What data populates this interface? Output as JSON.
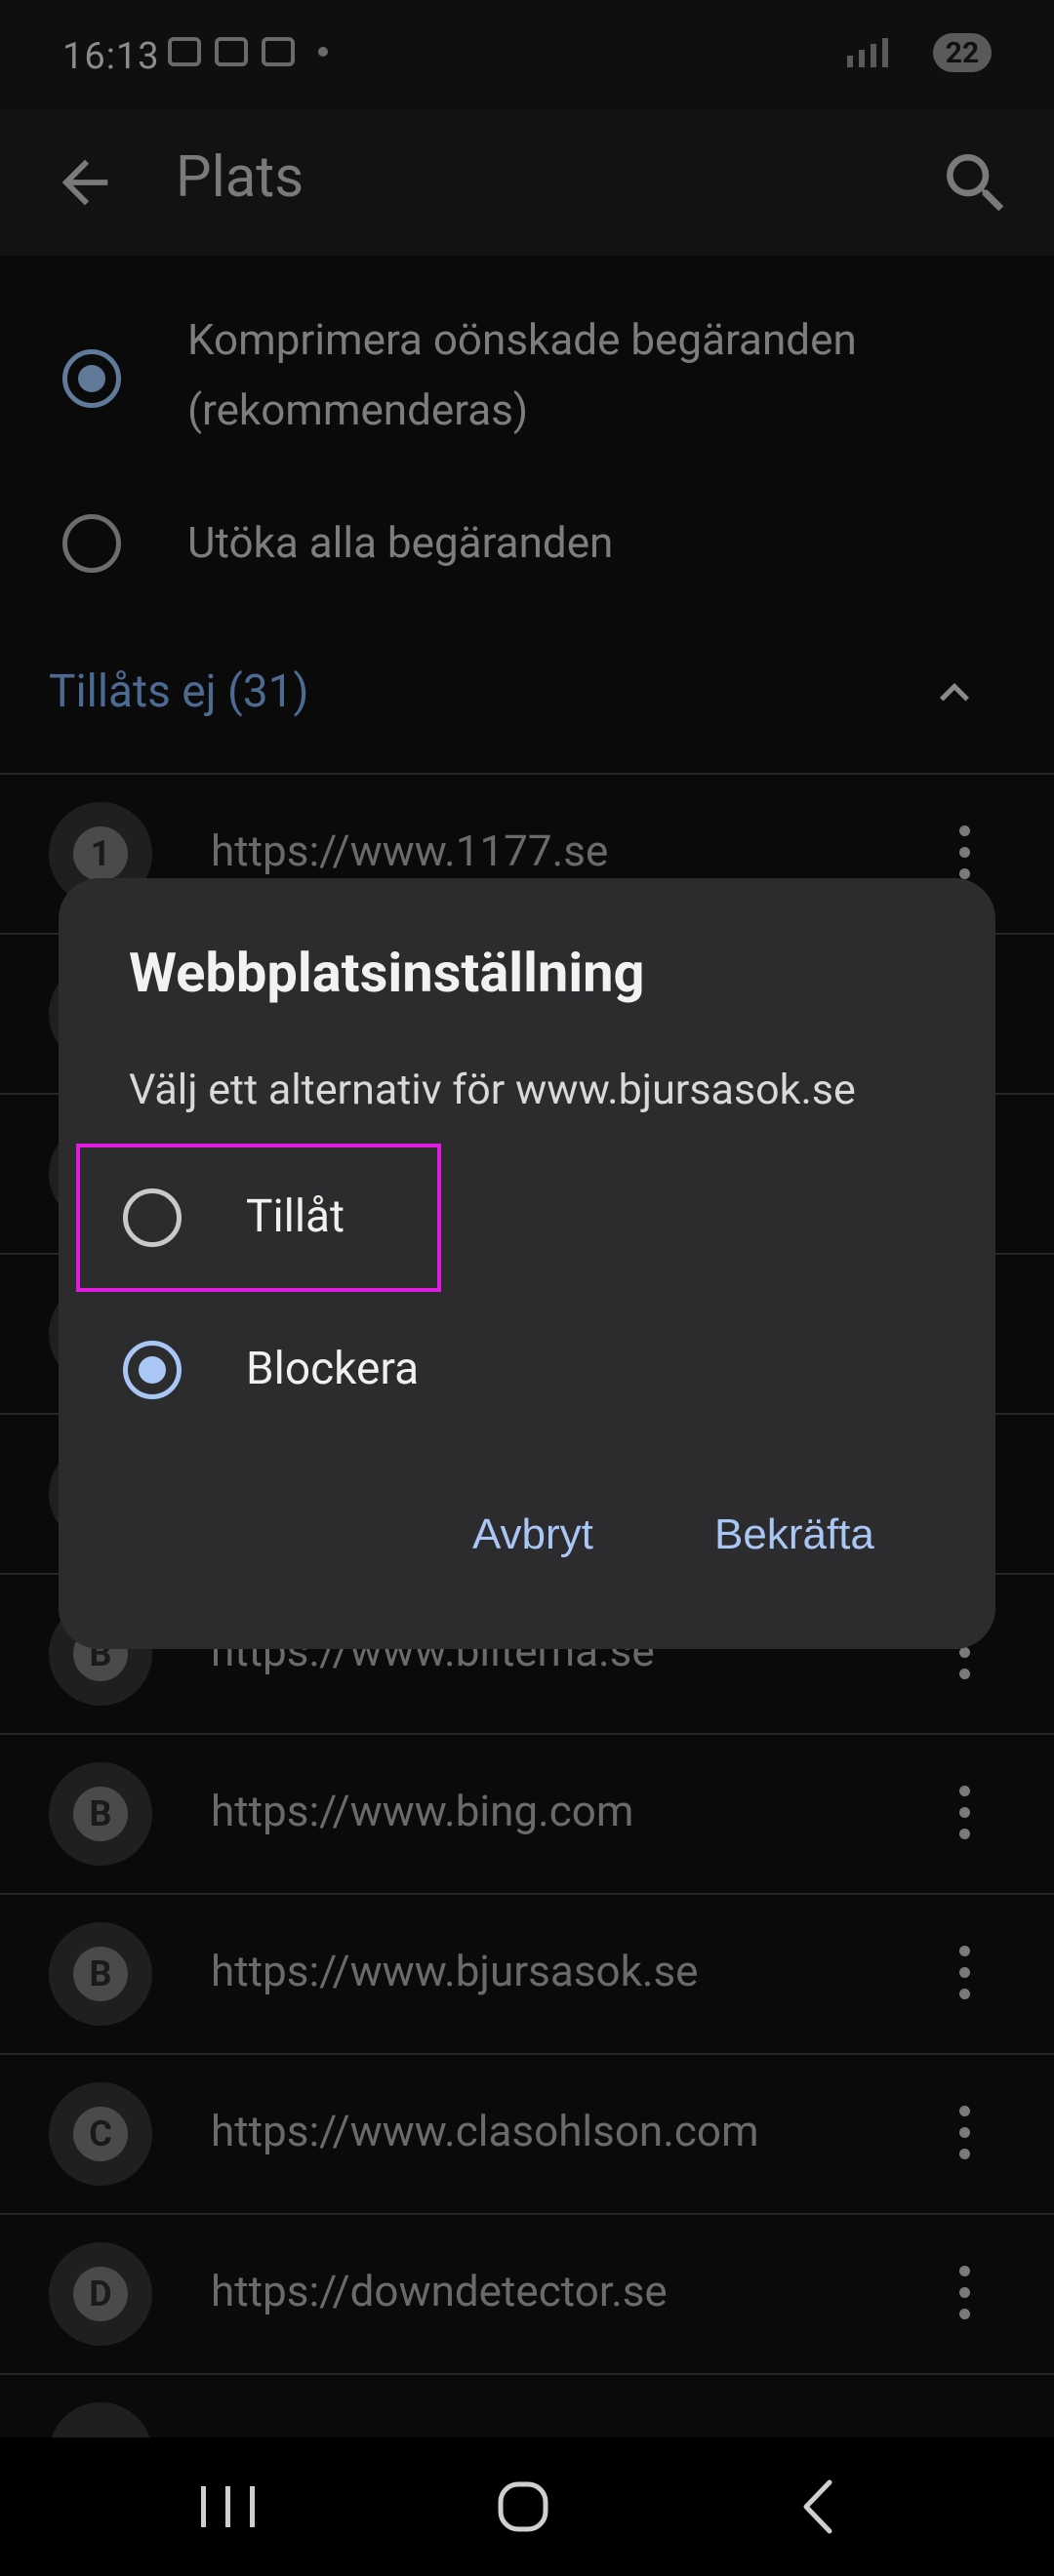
{
  "status_bar": {
    "time": "16:13",
    "battery": "22"
  },
  "app_bar": {
    "title": "Plats"
  },
  "options": [
    {
      "label": "Komprimera oönskade begäranden (rekommenderas)",
      "selected": true
    },
    {
      "label": "Utöka alla begäranden",
      "selected": false
    }
  ],
  "section": {
    "title": "Tillåts ej (31)"
  },
  "sites": [
    {
      "letter": "1",
      "url": "https://www.1177.se"
    },
    {
      "letter": "",
      "url": ""
    },
    {
      "letter": "",
      "url": ""
    },
    {
      "letter": "",
      "url": ""
    },
    {
      "letter": "",
      "url": ""
    },
    {
      "letter": "B",
      "url": "https://www.biltema.se"
    },
    {
      "letter": "B",
      "url": "https://www.bing.com"
    },
    {
      "letter": "B",
      "url": "https://www.bjursasok.se"
    },
    {
      "letter": "C",
      "url": "https://www.clasohlson.com"
    },
    {
      "letter": "D",
      "url": "https://downdetector.se"
    }
  ],
  "dialog": {
    "title": "Webbplatsinställning",
    "subtitle": "Välj ett alternativ för www.bjursasok.se",
    "options": [
      {
        "label": "Tillåt",
        "selected": false
      },
      {
        "label": "Blockera",
        "selected": true
      }
    ],
    "cancel_label": "Avbryt",
    "confirm_label": "Bekräfta"
  }
}
